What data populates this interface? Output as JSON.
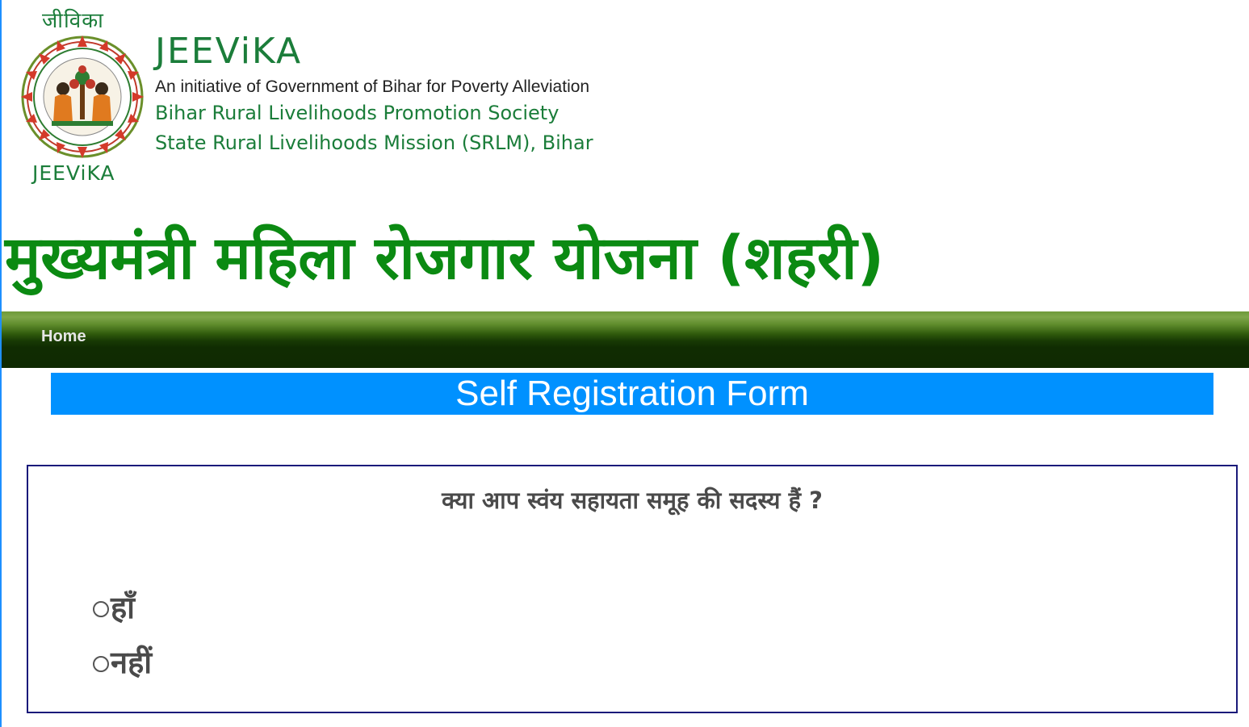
{
  "header": {
    "logo_top_text": "जीविका",
    "logo_bottom_text": "JEEViKA",
    "brand_name": "JEEViKA",
    "tagline": "An initiative of Government of Bihar for Poverty Alleviation",
    "org_line_1": "Bihar Rural Livelihoods Promotion Society",
    "org_line_2": "State Rural Livelihoods Mission (SRLM), Bihar"
  },
  "scheme_title": "मुख्यमंत्री महिला रोजगार योजना (शहरी)",
  "nav": {
    "home_label": "Home"
  },
  "form": {
    "title": "Self Registration Form",
    "question": "क्या आप स्वंय सहायता समूह की सदस्य हैं ?",
    "options": [
      {
        "label": "हाँ",
        "selected": false
      },
      {
        "label": "नहीं",
        "selected": false
      }
    ]
  },
  "colors": {
    "brand_green": "#1b7d3a",
    "title_green": "#0b8a12",
    "form_title_bg": "#0091ff",
    "box_border": "#1a1a7a"
  }
}
